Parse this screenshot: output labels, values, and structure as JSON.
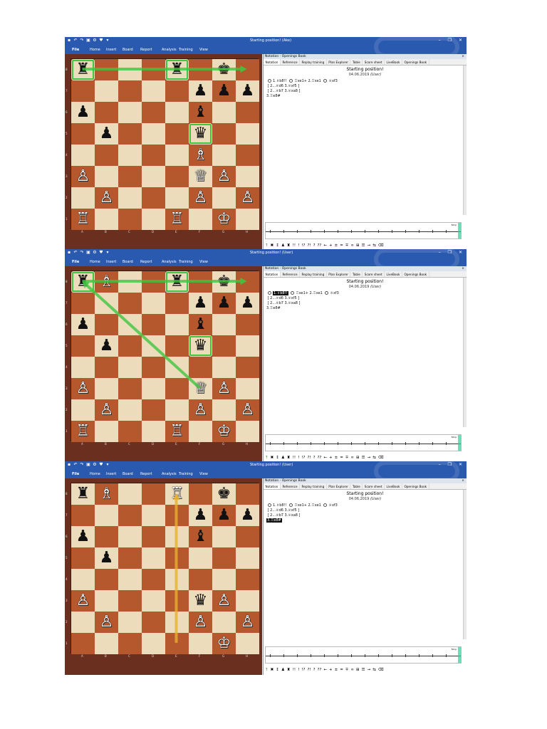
{
  "app": {
    "window_title_top": "Starting position! (Ake)",
    "window_title": "Starting position! (User)",
    "menu": [
      "File",
      "Home",
      "Insert",
      "Board",
      "Report",
      "Analysis",
      "Training",
      "View"
    ],
    "panel_header": "Notation - Openings Book",
    "panel_close": "×",
    "tabs": [
      "Notation",
      "Reference",
      "Replay training",
      "Plan Explorer",
      "Table",
      "Score sheet",
      "LiveBook",
      "Openings Book"
    ],
    "quick_access_icons": [
      "save-icon",
      "undo-icon",
      "redo-icon",
      "print-icon",
      "settings-icon",
      "heart-icon",
      "more-icon"
    ],
    "window_controls": [
      "minimize",
      "maximize",
      "close"
    ],
    "glyph_bar": [
      "↑",
      "✖",
      "↕",
      "♟",
      "♜",
      "!!",
      "!",
      "!?",
      "?!",
      "?",
      "??",
      "←",
      "+",
      "±",
      "=",
      "∓",
      "∞",
      "⊞",
      "☰",
      "→",
      "⇆",
      "⌫"
    ],
    "graph_label": "50cp"
  },
  "notation": {
    "title": "Starting position!",
    "date": "04.06.2019",
    "user": "(User)",
    "line1": {
      "m1": "1.♗b8!!",
      "m2": "♖xe1+",
      "m3": "2.♖xe1",
      "m4": "♕xf3"
    },
    "line2": "[ 2...♕d6 3.♕xf5 ]",
    "line3": "[ 2...♕b7 3.♕xa8 ]",
    "line4": "3.♖e8#"
  },
  "files": [
    "A",
    "B",
    "C",
    "D",
    "E",
    "F",
    "G",
    "H"
  ],
  "ranks": [
    "8",
    "7",
    "6",
    "5",
    "4",
    "3",
    "2",
    "1"
  ],
  "screens": [
    {
      "name": "before",
      "selected": "none",
      "board": [
        [
          "br",
          "",
          "",
          "",
          "br",
          "",
          "bk",
          ""
        ],
        [
          "",
          "",
          "",
          "",
          "",
          "bp",
          "bp",
          "bp"
        ],
        [
          "bp",
          "",
          "",
          "",
          "",
          "bb",
          "",
          ""
        ],
        [
          "",
          "bp",
          "",
          "",
          "",
          "bq",
          "",
          ""
        ],
        [
          "",
          "",
          "",
          "",
          "",
          "wb",
          "",
          ""
        ],
        [
          "wp",
          "",
          "",
          "",
          "",
          "wq",
          "wp",
          ""
        ],
        [
          "",
          "wp",
          "",
          "",
          "",
          "wp",
          "",
          "wp"
        ],
        [
          "wr",
          "",
          "",
          "",
          "wr",
          "",
          "wk",
          ""
        ]
      ],
      "highlights": [
        "a8",
        "e8",
        "f5"
      ],
      "arrows": [
        {
          "from": "a8",
          "to": "h8",
          "color": "#3fc53f"
        }
      ]
    },
    {
      "name": "after-bishop-b8",
      "selected": "m1",
      "board": [
        [
          "br",
          "wb",
          "",
          "",
          "br",
          "",
          "bk",
          ""
        ],
        [
          "",
          "",
          "",
          "",
          "",
          "bp",
          "bp",
          "bp"
        ],
        [
          "bp",
          "",
          "",
          "",
          "",
          "bb",
          "",
          ""
        ],
        [
          "",
          "bp",
          "",
          "",
          "",
          "bq",
          "",
          ""
        ],
        [
          "",
          "",
          "",
          "",
          "",
          "",
          "",
          ""
        ],
        [
          "wp",
          "",
          "",
          "",
          "",
          "wq",
          "wp",
          ""
        ],
        [
          "",
          "wp",
          "",
          "",
          "",
          "wp",
          "",
          "wp"
        ],
        [
          "wr",
          "",
          "",
          "",
          "wr",
          "",
          "wk",
          ""
        ]
      ],
      "highlights": [
        "a8",
        "e8",
        "f5"
      ],
      "arrows": [
        {
          "from": "a8",
          "to": "h8",
          "color": "#3fc53f"
        },
        {
          "from": "f3",
          "to": "a8",
          "color": "#3fc53f"
        }
      ]
    },
    {
      "name": "final-mate",
      "selected": "line4",
      "board": [
        [
          "br",
          "wb",
          "",
          "",
          "wr",
          "",
          "bk",
          ""
        ],
        [
          "",
          "",
          "",
          "",
          "",
          "bp",
          "bp",
          "bp"
        ],
        [
          "bp",
          "",
          "",
          "",
          "",
          "bb",
          "",
          ""
        ],
        [
          "",
          "bp",
          "",
          "",
          "",
          "",
          "",
          ""
        ],
        [
          "",
          "",
          "",
          "",
          "",
          "",
          "",
          ""
        ],
        [
          "wp",
          "",
          "",
          "",
          "",
          "bq",
          "wp",
          ""
        ],
        [
          "",
          "wp",
          "",
          "",
          "",
          "wp",
          "",
          "wp"
        ],
        [
          "",
          "",
          "",
          "",
          "",
          "",
          "wk",
          ""
        ]
      ],
      "highlights": [],
      "arrows": [
        {
          "from": "e1",
          "to": "e8",
          "color": "#e8b030"
        }
      ]
    }
  ],
  "colors": {
    "titlebar": "#2a59b0",
    "board_dark": "#b5582e",
    "board_light": "#ecdcbc",
    "frame": "#6a2f1f",
    "arrow_green": "#3fc53f",
    "arrow_gold": "#e8b030"
  }
}
